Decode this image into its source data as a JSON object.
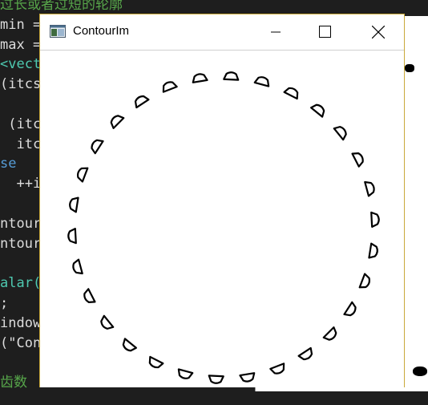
{
  "editor": {
    "lines": [
      {
        "text": "过长或者过短的轮廓",
        "cls": "c-comment"
      },
      {
        "text": "min =",
        "cls": ""
      },
      {
        "text": "max =",
        "cls": ""
      },
      {
        "text": "<vecto",
        "cls": "c-type"
      },
      {
        "text": "(itcs",
        "cls": ""
      },
      {
        "text": "",
        "cls": ""
      },
      {
        "text": " (itcs",
        "cls": ""
      },
      {
        "text": "  itcs",
        "cls": ""
      },
      {
        "text": "se",
        "cls": "c-kw"
      },
      {
        "text": "  ++i",
        "cls": ""
      },
      {
        "text": "",
        "cls": ""
      },
      {
        "text": "ntourl",
        "cls": ""
      },
      {
        "text": "ntours",
        "cls": ""
      },
      {
        "text": "",
        "cls": ""
      },
      {
        "text": "alar((",
        "cls": "c-type"
      },
      {
        "text": ";",
        "cls": ""
      },
      {
        "text": "indow",
        "cls": ""
      },
      {
        "text": "(\"Cont",
        "cls": ""
      },
      {
        "text": "",
        "cls": ""
      },
      {
        "text": "齿数",
        "cls": "c-comment"
      }
    ]
  },
  "window": {
    "title": "ContourIm",
    "icon": "app-window-icon",
    "controls": [
      "minimize-icon",
      "maximize-icon",
      "close-icon"
    ]
  },
  "image": {
    "description_shape_count": 30,
    "stroke_color": "#000000",
    "background_color": "#ffffff"
  }
}
